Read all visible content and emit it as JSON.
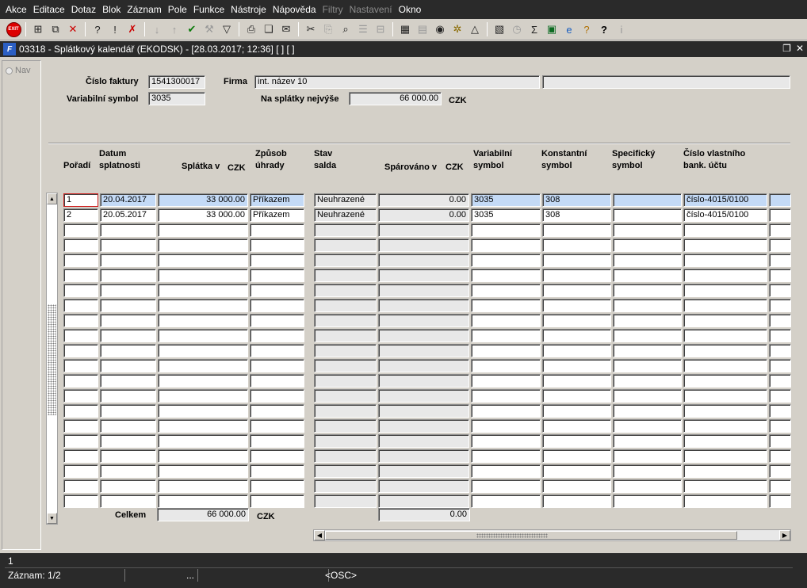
{
  "menu": [
    "Akce",
    "Editace",
    "Dotaz",
    "Blok",
    "Záznam",
    "Pole",
    "Funkce",
    "Nástroje",
    "Nápověda",
    "Filtry",
    "Nastavení",
    "Okno"
  ],
  "menu_disabled": [
    "Filtry",
    "Nastavení"
  ],
  "toolbar": {
    "exit_label": "EXIT",
    "icons": [
      "exit-icon",
      "insert-record-icon",
      "duplicate-record-icon",
      "delete-record-icon",
      "enter-query-icon",
      "execute-query-icon",
      "cancel-query-icon",
      "sort-asc-icon",
      "sort-desc-icon",
      "commit-checkmark-icon",
      "tools-wrench-icon",
      "filter-funnel-icon",
      "print-icon",
      "email-icon",
      "cut-icon",
      "copy-icon",
      "paste-icon",
      "list-icon",
      "tree-icon",
      "calendar-icon",
      "globe-icon",
      "gear-icon",
      "triangle-icon",
      "report-icon",
      "sum-icon",
      "excel-icon",
      "internet-icon",
      "help-icon",
      "context-help-icon",
      "info-icon"
    ]
  },
  "window": {
    "title": "03318 - Splátkový kalendář (EKODSK) - [28.03.2017; 12:36]  [ ]  [ ]",
    "logo": "F"
  },
  "nav": {
    "label": "Nav"
  },
  "header": {
    "invoice_label": "Číslo faktury",
    "invoice_value": "1541300017",
    "firm_label": "Firma",
    "firm_value": "int. název 10",
    "firm_extra": "",
    "varsym_label": "Variabilní symbol",
    "varsym_value": "3035",
    "max_label": "Na splátky nejvýše",
    "max_value": "66 000.00",
    "currency": "CZK"
  },
  "columns": {
    "poradi": "Pořadí",
    "datum1": "Datum",
    "datum2": "splatnosti",
    "splatka": "Splátka v",
    "splatka_cur": "CZK",
    "zpusob1": "Způsob",
    "zpusob2": "úhrady",
    "stav1": "Stav",
    "stav2": "salda",
    "sparovano": "Spárováno v",
    "sparovano_cur": "CZK",
    "var1": "Variabilní",
    "var2": "symbol",
    "konst1": "Konstantní",
    "konst2": "symbol",
    "spec1": "Specifický",
    "spec2": "symbol",
    "ucet1": "Číslo vlastního",
    "ucet2": "bank. účtu"
  },
  "rows": [
    {
      "poradi": "1",
      "datum": "20.04.2017",
      "splatka": "33 000.00",
      "zpusob": "Příkazem",
      "stav": "Neuhrazené",
      "sparovano": "0.00",
      "var": "3035",
      "konst": "308",
      "spec": "",
      "ucet": "číslo-4015/0100"
    },
    {
      "poradi": "2",
      "datum": "20.05.2017",
      "splatka": "33 000.00",
      "zpusob": "Příkazem",
      "stav": "Neuhrazené",
      "sparovano": "0.00",
      "var": "3035",
      "konst": "308",
      "spec": "",
      "ucet": "číslo-4015/0100"
    }
  ],
  "empty_rows": 19,
  "totals": {
    "label": "Celkem",
    "splatka": "66 000.00",
    "currency": "CZK",
    "sparovano": "0.00"
  },
  "status": {
    "message": "1",
    "record": "Záznam: 1/2",
    "ellipsis": "...",
    "osc": "<OSC>"
  }
}
